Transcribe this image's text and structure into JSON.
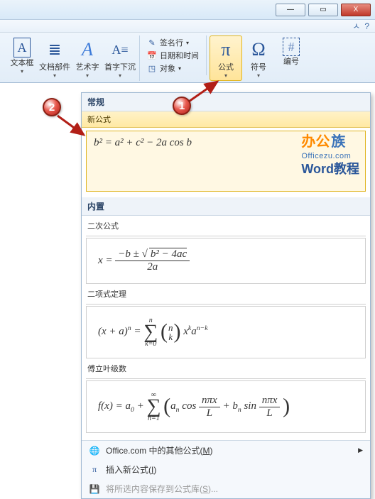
{
  "window": {
    "minimize": "—",
    "maximize": "▭",
    "close": "X"
  },
  "help": {
    "up": "ㅅ",
    "q": "?"
  },
  "ribbon": {
    "group1": {
      "textbox": {
        "label": "文本框",
        "glyph": "A"
      },
      "quickparts": {
        "label": "文档部件",
        "glyph": "≣"
      },
      "wordart": {
        "label": "艺术字",
        "glyph": "A"
      },
      "dropcap": {
        "label": "首字下沉",
        "glyph": "A≡"
      }
    },
    "textextras": {
      "signature": "签名行",
      "datetime": "日期和时间",
      "object": "对象"
    },
    "group2": {
      "equation": {
        "label": "公式",
        "glyph": "π"
      },
      "symbol": {
        "label": "符号",
        "glyph": "Ω"
      },
      "number": {
        "label": "编号",
        "glyph": "#"
      }
    }
  },
  "dropdown": {
    "header": "常规",
    "newEq": "新公式",
    "newEqFormula": "b² = a² + c² − 2a cos b",
    "builtinHeader": "内置",
    "sections": {
      "quadratic": {
        "label": "二次公式"
      },
      "binomial": {
        "label": "二项式定理"
      },
      "fourier": {
        "label": "傅立叶级数"
      }
    },
    "footer": {
      "office": {
        "label_pre": "Office.com 中的其他公式(",
        "key": "M",
        "label_post": ")"
      },
      "insert": {
        "label_pre": "插入新公式(",
        "key": "I",
        "label_post": ")"
      },
      "save": {
        "label_pre": "将所选内容保存到公式库(",
        "key": "S",
        "label_post": ")..."
      }
    }
  },
  "watermark": {
    "brand1a": "办公",
    "brand1b": "族",
    "brand2": "Officezu.com",
    "brand3": "Word教程"
  },
  "callouts": {
    "one": "1",
    "two": "2"
  },
  "formulas": {
    "quadratic": {
      "lhs": "x =",
      "num_pre": "−b ± ",
      "num_sqrt": "b² − 4ac",
      "den": "2a"
    },
    "binomial": {
      "lhs": "(x + a)",
      "exp": "n",
      "sum_top": "n",
      "sum_bot": "k=0",
      "bin_top": "n",
      "bin_bot": "k",
      "rhs_x": "x",
      "rhs_xexp": "k",
      "rhs_a": "a",
      "rhs_aexp": "n−k"
    },
    "fourier": {
      "lhs": "f(x) = a",
      "a0sub": "0",
      "plus": " + ",
      "sum_top": "∞",
      "sum_bot": "n=1",
      "an": "a",
      "ansub": "n",
      "cos": " cos",
      "frac_num": "nπx",
      "frac_den": "L",
      "bn": "b",
      "bnsub": "n",
      "sin": " sin"
    }
  }
}
